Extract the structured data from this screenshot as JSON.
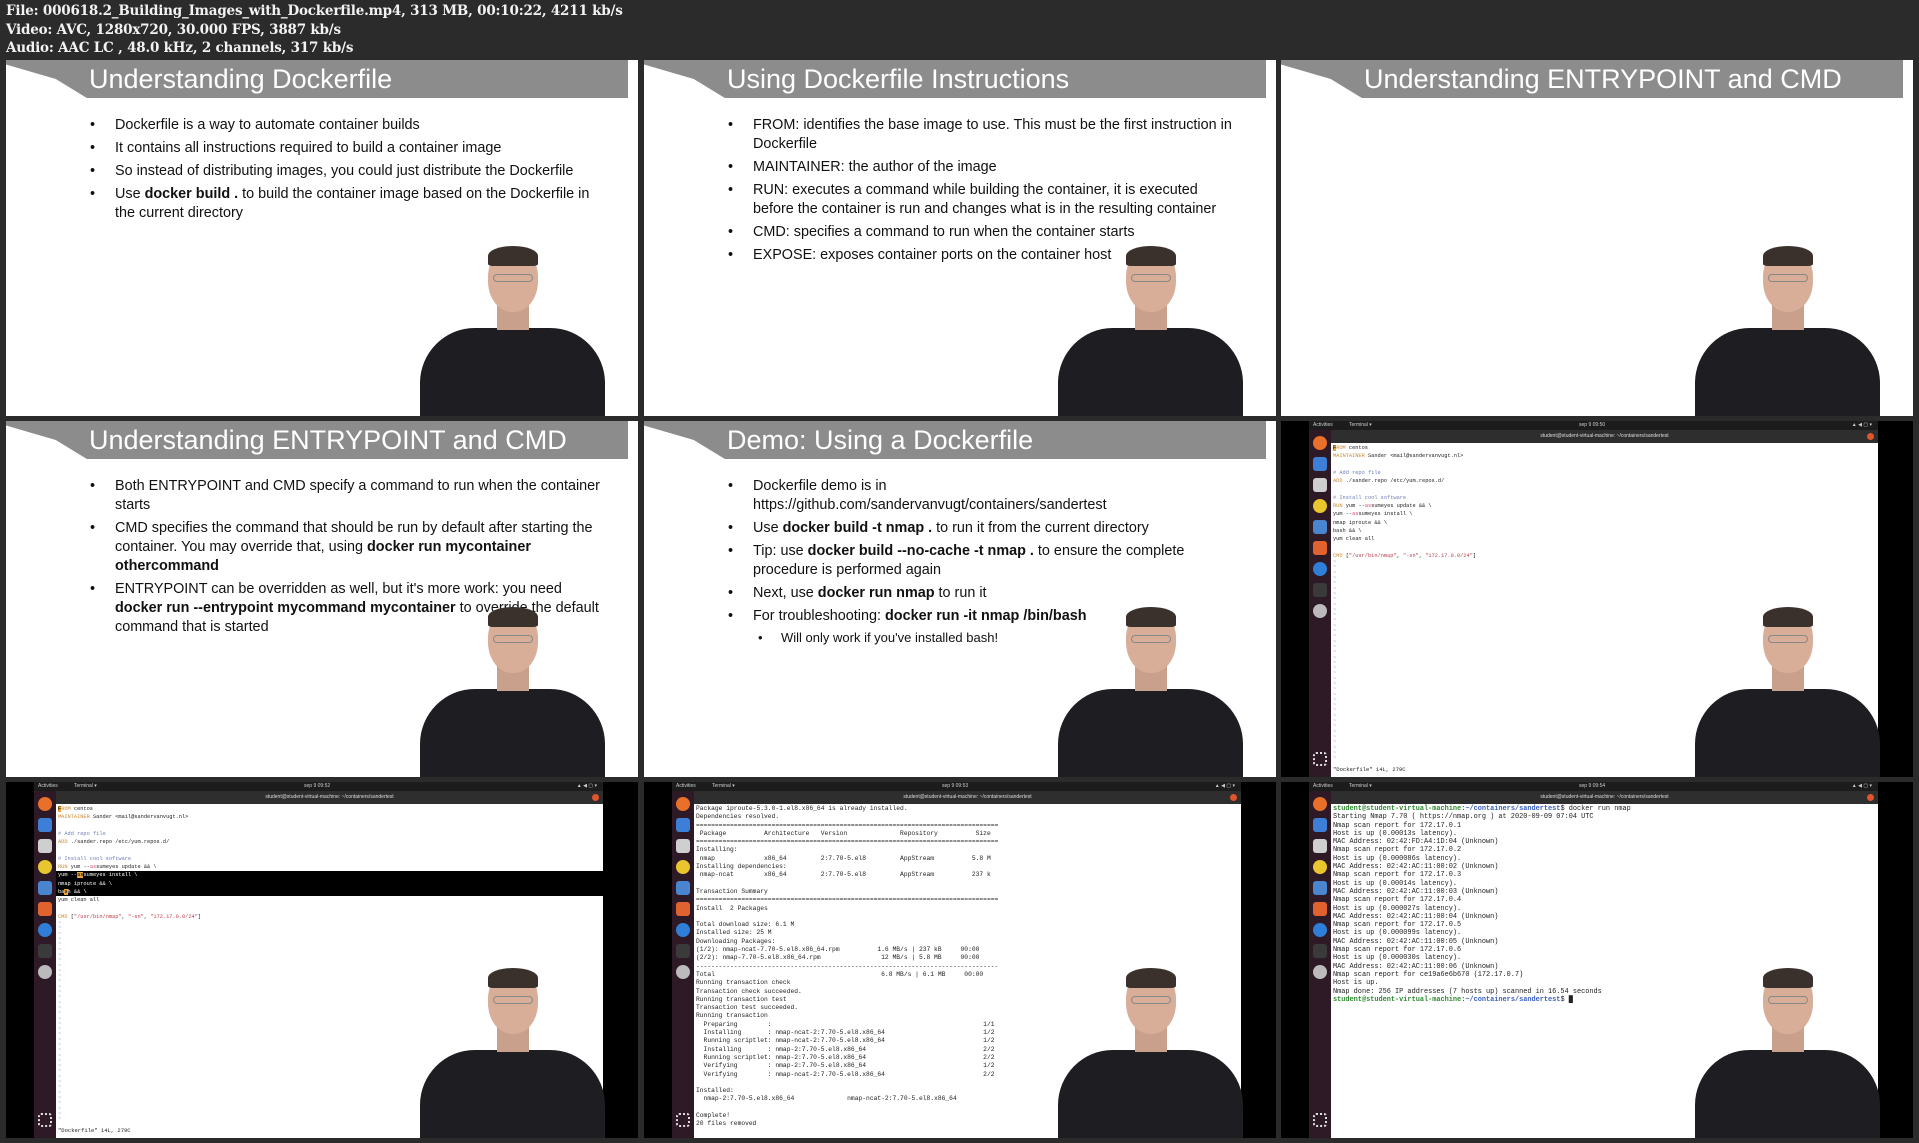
{
  "file_info": [
    "File: 000618.2_Building_Images_with_Dockerfile.mp4, 313 MB, 00:10:22, 4211 kb/s",
    "Video: AVC, 1280x720, 30.000 FPS, 3887 kb/s",
    "Audio: AAC LC , 48.0 kHz, 2 channels, 317 kb/s"
  ],
  "slides": [
    {
      "title": "Understanding Dockerfile",
      "bullets": [
        {
          "seg": [
            [
              "Dockerfile is a way to automate container builds",
              0
            ]
          ]
        },
        {
          "seg": [
            [
              "It contains all instructions required to build a container image",
              0
            ]
          ]
        },
        {
          "seg": [
            [
              "So instead of distributing images, you could just distribute the Dockerfile",
              0
            ]
          ]
        },
        {
          "seg": [
            [
              "Use ",
              0
            ],
            [
              "docker build .",
              1
            ],
            [
              " to build the container image based on the Dockerfile in the current directory",
              0
            ]
          ]
        }
      ]
    },
    {
      "title": "Using Dockerfile Instructions",
      "bullets": [
        {
          "seg": [
            [
              "FROM: identifies the base image to use. This must be the first instruction in Dockerfile",
              0
            ]
          ]
        },
        {
          "seg": [
            [
              "MAINTAINER: the author of the image",
              0
            ]
          ]
        },
        {
          "seg": [
            [
              "RUN: executes a command while building the container, it is executed before the container is run and changes what is in the resulting container",
              0
            ]
          ]
        },
        {
          "seg": [
            [
              "CMD: specifies a command to run when the container starts",
              0
            ]
          ]
        },
        {
          "seg": [
            [
              "EXPOSE: exposes container ports on the container host",
              0
            ]
          ]
        }
      ]
    },
    {
      "title": "Understanding ENTRYPOINT and CMD",
      "bullets": []
    },
    {
      "title": "Understanding ENTRYPOINT and CMD",
      "bullets": [
        {
          "seg": [
            [
              "Both ENTRYPOINT and CMD specify a command to run when the container starts",
              0
            ]
          ]
        },
        {
          "seg": [
            [
              "CMD specifies the command that should be run by default after starting the container. You may override that, using ",
              0
            ],
            [
              "docker run mycontainer othercommand",
              1
            ]
          ]
        },
        {
          "seg": [
            [
              "ENTRYPOINT can be overridden as well, but it's more work: you need ",
              0
            ],
            [
              "docker run --entrypoint mycommand mycontainer",
              1
            ],
            [
              " to override the default command that is started",
              0
            ]
          ]
        }
      ]
    },
    {
      "title": "Demo: Using a Dockerfile",
      "bullets": [
        {
          "seg": [
            [
              "Dockerfile demo is in https://github.com/sandervanvugt/containers/sandertest",
              0
            ]
          ]
        },
        {
          "seg": [
            [
              "Use ",
              0
            ],
            [
              "docker build -t nmap .",
              1
            ],
            [
              " to run it from the current directory",
              0
            ]
          ]
        },
        {
          "seg": [
            [
              "Tip: use ",
              0
            ],
            [
              "docker build --no-cache -t nmap .",
              1
            ],
            [
              " to ensure the complete procedure is performed again",
              0
            ]
          ]
        },
        {
          "seg": [
            [
              "Next, use ",
              0
            ],
            [
              "docker run nmap",
              1
            ],
            [
              " to run it",
              0
            ]
          ]
        },
        {
          "seg": [
            [
              "For troubleshooting: ",
              0
            ],
            [
              "docker run -it nmap /bin/bash",
              1
            ]
          ]
        },
        {
          "sub": true,
          "seg": [
            [
              "Will only work if you've installed bash!",
              0
            ]
          ]
        }
      ]
    }
  ],
  "terminals": [
    {
      "activities": "Activities",
      "app": "Terminal ▾",
      "clock": "sep 9 09:50",
      "title": "student@student-virtual-machine: ~/containers/sandertest",
      "mode": "vim",
      "status": "\"Dockerfile\" 14L, 279C",
      "filler": "~",
      "filler_count": 38,
      "highlight": [],
      "lines": [
        [
          [
            "F",
            "cur"
          ],
          [
            "ROM",
            "k"
          ],
          [
            " centos",
            ""
          ]
        ],
        [
          [
            "MAINTAINER",
            "k"
          ],
          [
            " Sander <mail@sandervanvugt.nl>",
            ""
          ]
        ],
        [],
        [
          [
            "# Add repo file",
            "cm"
          ]
        ],
        [
          [
            "ADD",
            "k"
          ],
          [
            " ./sander.repo /etc/yum.repos.d/",
            ""
          ]
        ],
        [],
        [
          [
            "# Install cool software",
            "cm"
          ]
        ],
        [
          [
            "RUN",
            "k"
          ],
          [
            " yum --",
            ""
          ],
          [
            "as",
            "r"
          ],
          [
            "sumeyes update && \\",
            ""
          ]
        ],
        [
          [
            "yum --",
            ""
          ],
          [
            "as",
            "r"
          ],
          [
            "sumeyes install \\",
            ""
          ]
        ],
        [
          [
            "nmap iproute && \\",
            ""
          ]
        ],
        [
          [
            "bash && \\",
            ""
          ]
        ],
        [
          [
            "yum clean all",
            ""
          ]
        ],
        [],
        [
          [
            "CMD",
            "k"
          ],
          [
            " [",
            ""
          ],
          [
            "\"/usr/bin/nmap\"",
            "s"
          ],
          [
            ", ",
            ""
          ],
          [
            "\"-sn\"",
            "s"
          ],
          [
            ", ",
            ""
          ],
          [
            "\"172.17.0.0/24\"",
            "s"
          ],
          [
            "]",
            ""
          ]
        ]
      ]
    },
    {
      "activities": "Activities",
      "app": "Terminal ▾",
      "clock": "sep 9 09:52",
      "title": "student@student-virtual-machine: ~/containers/sandertest",
      "mode": "vim",
      "status": "\"Dockerfile\" 14L, 279C",
      "filler": "~",
      "filler_count": 38,
      "highlight": [
        8,
        9,
        10
      ],
      "lines": [
        [
          [
            "F",
            "cur"
          ],
          [
            "ROM",
            "k"
          ],
          [
            " centos",
            ""
          ]
        ],
        [
          [
            "MAINTAINER",
            "k"
          ],
          [
            " Sander <mail@sandervanvugt.nl>",
            ""
          ]
        ],
        [],
        [
          [
            "# Add repo file",
            "cm"
          ]
        ],
        [
          [
            "ADD",
            "k"
          ],
          [
            " ./sander.repo /etc/yum.repos.d/",
            ""
          ]
        ],
        [],
        [
          [
            "# Install cool software",
            "cm"
          ]
        ],
        [
          [
            "RUN",
            "k"
          ],
          [
            " yum --",
            ""
          ],
          [
            "as",
            "r"
          ],
          [
            "sumeyes update && \\",
            ""
          ]
        ],
        [
          [
            "yum --",
            ""
          ],
          [
            "as",
            "cur"
          ],
          [
            "sumeyes install \\",
            ""
          ]
        ],
        [
          [
            "nmap iproute && \\",
            ""
          ]
        ],
        [
          [
            "ba",
            ""
          ],
          [
            "s",
            "cur"
          ],
          [
            "h && \\",
            ""
          ]
        ],
        [
          [
            "yum clean all",
            ""
          ]
        ],
        [],
        [
          [
            "CMD",
            "k"
          ],
          [
            " [",
            ""
          ],
          [
            "\"/usr/bin/nmap\"",
            "s"
          ],
          [
            ", ",
            ""
          ],
          [
            "\"-sn\"",
            "s"
          ],
          [
            ", ",
            ""
          ],
          [
            "\"172.17.0.0/24\"",
            "s"
          ],
          [
            "]",
            ""
          ]
        ]
      ]
    },
    {
      "activities": "Activities",
      "app": "Terminal ▾",
      "clock": "sep 9 09:53",
      "title": "student@student-virtual-machine: ~/containers/sandertest",
      "mode": "dnf",
      "status": "",
      "filler": "",
      "filler_count": 0,
      "highlight": [],
      "lines": [
        [
          [
            "Package iproute-5.3.0-1.el8.x86_64 is already installed.",
            ""
          ]
        ],
        [
          [
            "Dependencies resolved.",
            ""
          ]
        ],
        [
          [
            "================================================================================",
            ""
          ]
        ],
        [
          [
            " Package          Architecture   Version              Repository          Size",
            ""
          ]
        ],
        [
          [
            "================================================================================",
            ""
          ]
        ],
        [
          [
            "Installing:",
            ""
          ]
        ],
        [
          [
            " nmap             x86_64         2:7.70-5.el8         AppStream          5.8 M",
            ""
          ]
        ],
        [
          [
            "Installing dependencies:",
            ""
          ]
        ],
        [
          [
            " nmap-ncat        x86_64         2:7.70-5.el8         AppStream          237 k",
            ""
          ]
        ],
        [
          [],
          []
        ],
        [
          [
            "Transaction Summary",
            ""
          ]
        ],
        [
          [
            "================================================================================",
            ""
          ]
        ],
        [
          [
            "Install  2 Packages",
            ""
          ]
        ],
        [],
        [
          [
            "Total download size: 6.1 M",
            ""
          ]
        ],
        [
          [
            "Installed size: 25 M",
            ""
          ]
        ],
        [
          [
            "Downloading Packages:",
            ""
          ]
        ],
        [
          [
            "(1/2): nmap-ncat-7.70-5.el8.x86_64.rpm          1.6 MB/s | 237 kB     00:00",
            ""
          ]
        ],
        [
          [
            "(2/2): nmap-7.70-5.el8.x86_64.rpm                12 MB/s | 5.8 MB     00:00",
            ""
          ]
        ],
        [
          [
            "--------------------------------------------------------------------------------",
            ""
          ]
        ],
        [
          [
            "Total                                            6.8 MB/s | 6.1 MB     00:00",
            ""
          ]
        ],
        [
          [
            "Running transaction check",
            ""
          ]
        ],
        [
          [
            "Transaction check succeeded.",
            ""
          ]
        ],
        [
          [
            "Running transaction test",
            ""
          ]
        ],
        [
          [
            "Transaction test succeeded.",
            ""
          ]
        ],
        [
          [
            "Running transaction",
            ""
          ]
        ],
        [
          [
            "  Preparing        :                                                        1/1",
            ""
          ]
        ],
        [
          [
            "  Installing       : nmap-ncat-2:7.70-5.el8.x86_64                          1/2",
            ""
          ]
        ],
        [
          [
            "  Running scriptlet: nmap-ncat-2:7.70-5.el8.x86_64                          1/2",
            ""
          ]
        ],
        [
          [
            "  Installing       : nmap-2:7.70-5.el8.x86_64                               2/2",
            ""
          ]
        ],
        [
          [
            "  Running scriptlet: nmap-2:7.70-5.el8.x86_64                               2/2",
            ""
          ]
        ],
        [
          [
            "  Verifying        : nmap-2:7.70-5.el8.x86_64                               1/2",
            ""
          ]
        ],
        [
          [
            "  Verifying        : nmap-ncat-2:7.70-5.el8.x86_64                          2/2",
            ""
          ]
        ],
        [],
        [
          [
            "Installed:",
            ""
          ]
        ],
        [
          [
            "  nmap-2:7.70-5.el8.x86_64              nmap-ncat-2:7.70-5.el8.x86_64",
            ""
          ]
        ],
        [],
        [
          [
            "Complete!",
            ""
          ]
        ],
        [
          [
            "20 files removed",
            ""
          ]
        ]
      ]
    },
    {
      "activities": "Activities",
      "app": "Terminal ▾",
      "clock": "sep 9 09:54",
      "title": "student@student-virtual-machine: ~/containers/sandertest",
      "mode": "nm",
      "status": "",
      "filler": "",
      "filler_count": 0,
      "highlight": [],
      "lines": [
        [
          [
            "student@student-virtual-machine",
            "u"
          ],
          [
            ":",
            ""
          ],
          [
            "~/containers/sandertest",
            "p"
          ],
          [
            "$ docker run nmap",
            ""
          ]
        ],
        [
          [
            "Starting Nmap 7.70 ( https://nmap.org ) at 2020-09-09 07:04 UTC",
            ""
          ]
        ],
        [
          [
            "Nmap scan report for 172.17.0.1",
            ""
          ]
        ],
        [
          [
            "Host is up (0.00013s latency).",
            ""
          ]
        ],
        [
          [
            "MAC Address: 02:42:FD:A4:1D:04 (Unknown)",
            ""
          ]
        ],
        [
          [
            "Nmap scan report for 172.17.0.2",
            ""
          ]
        ],
        [
          [
            "Host is up (0.000086s latency).",
            ""
          ]
        ],
        [
          [
            "MAC Address: 02:42:AC:11:00:02 (Unknown)",
            ""
          ]
        ],
        [
          [
            "Nmap scan report for 172.17.0.3",
            ""
          ]
        ],
        [
          [
            "Host is up (0.00014s latency).",
            ""
          ]
        ],
        [
          [
            "MAC Address: 02:42:AC:11:00:03 (Unknown)",
            ""
          ]
        ],
        [
          [
            "Nmap scan report for 172.17.0.4",
            ""
          ]
        ],
        [
          [
            "Host is up (0.000027s latency).",
            ""
          ]
        ],
        [
          [
            "MAC Address: 02:42:AC:11:00:04 (Unknown)",
            ""
          ]
        ],
        [
          [
            "Nmap scan report for 172.17.0.5",
            ""
          ]
        ],
        [
          [
            "Host is up (0.000099s latency).",
            ""
          ]
        ],
        [
          [
            "MAC Address: 02:42:AC:11:00:05 (Unknown)",
            ""
          ]
        ],
        [
          [
            "Nmap scan report for 172.17.0.6",
            ""
          ]
        ],
        [
          [
            "Host is up (0.000030s latency).",
            ""
          ]
        ],
        [
          [
            "MAC Address: 02:42:AC:11:00:06 (Unknown)",
            ""
          ]
        ],
        [
          [
            "Nmap scan report for ce19a6e6b670 (172.17.0.7)",
            ""
          ]
        ],
        [
          [
            "Host is up.",
            ""
          ]
        ],
        [
          [
            "Nmap done: 256 IP addresses (7 hosts up) scanned in 16.54 seconds",
            ""
          ]
        ],
        [
          [
            "student@student-virtual-machine",
            "u"
          ],
          [
            ":",
            ""
          ],
          [
            "~/containers/sandertest",
            "p"
          ],
          [
            "$ ",
            ""
          ],
          [
            "█",
            ""
          ]
        ]
      ]
    }
  ],
  "dock_icons": [
    "firefox-icon",
    "thunderbird-icon",
    "files-icon",
    "rhythmbox-icon",
    "writer-icon",
    "software-icon",
    "help-icon",
    "terminal-icon",
    "dvd-icon",
    "apps-grid-icon"
  ],
  "dock_colors": [
    "#e8702a",
    "#3d7fd6",
    "#cfcfcf",
    "#e9c62e",
    "#4a86cf",
    "#e0632f",
    "#2f7fd8",
    "#3a3a3a",
    "#bbbbbb",
    "#dddddd"
  ]
}
